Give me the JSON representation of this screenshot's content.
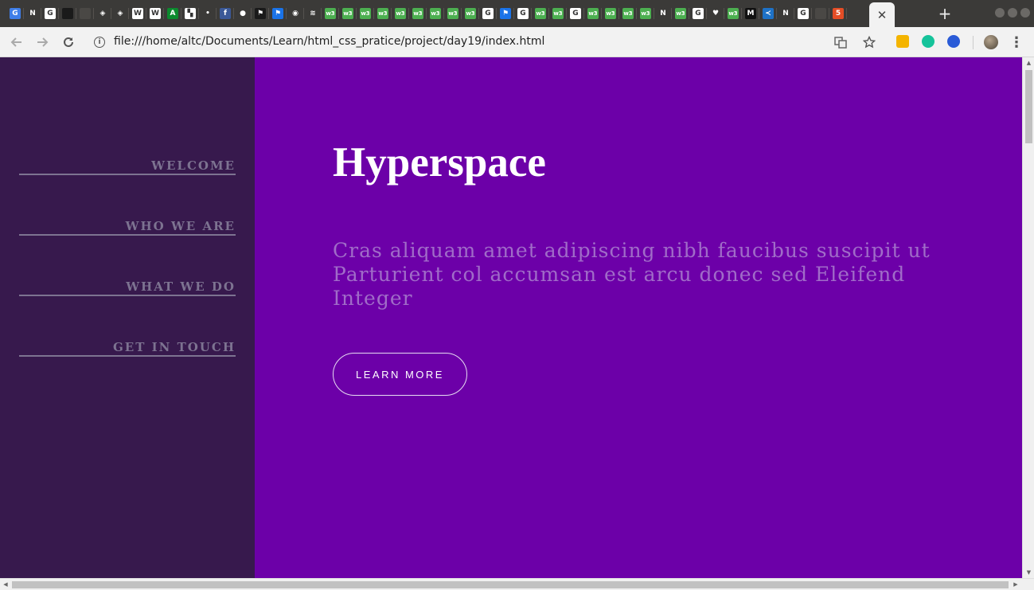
{
  "browser": {
    "tabs": [
      {
        "icon": "google-drive-icon",
        "glyph": "G",
        "color": "#3f7ee8"
      },
      {
        "icon": "n-tab-icon",
        "glyph": "N",
        "color": "#3b3a38"
      },
      {
        "icon": "google-icon",
        "glyph": "G",
        "color": "#ffffff"
      },
      {
        "icon": "save-icon",
        "glyph": "",
        "color": "#1a1a1a"
      },
      {
        "icon": "blank-page-icon",
        "glyph": "",
        "color": "#4a4845"
      },
      {
        "icon": "codepen-icon",
        "glyph": "◈",
        "color": "#3b3a38"
      },
      {
        "icon": "codepen-icon",
        "glyph": "◈",
        "color": "#3b3a38"
      },
      {
        "icon": "wikipedia-icon",
        "glyph": "W",
        "color": "#ffffff"
      },
      {
        "icon": "wikipedia-icon",
        "glyph": "W",
        "color": "#ffffff"
      },
      {
        "icon": "green-a-icon",
        "glyph": "A",
        "color": "#0b8a2e"
      },
      {
        "icon": "checker-icon",
        "glyph": "▚",
        "color": "#ffffff"
      },
      {
        "icon": "dots-icon",
        "glyph": "•",
        "color": "#3b3a38"
      },
      {
        "icon": "facebook-icon",
        "glyph": "f",
        "color": "#3b5998"
      },
      {
        "icon": "github-icon",
        "glyph": "●",
        "color": "#3b3a38"
      },
      {
        "icon": "flag-icon",
        "glyph": "⚑",
        "color": "#1a1a1a"
      },
      {
        "icon": "flag-blue-icon",
        "glyph": "⚑",
        "color": "#1a73e8"
      },
      {
        "icon": "circle-icon",
        "glyph": "◉",
        "color": "#3b3a38"
      },
      {
        "icon": "stack-icon",
        "glyph": "≋",
        "color": "#3b3a38"
      },
      {
        "icon": "w3-icon",
        "glyph": "w3",
        "color": "#4caf50"
      },
      {
        "icon": "w3-icon",
        "glyph": "w3",
        "color": "#4caf50"
      },
      {
        "icon": "w3-icon",
        "glyph": "w3",
        "color": "#4caf50"
      },
      {
        "icon": "w3-icon",
        "glyph": "w3",
        "color": "#4caf50"
      },
      {
        "icon": "w3-icon",
        "glyph": "w3",
        "color": "#4caf50"
      },
      {
        "icon": "w3-icon",
        "glyph": "w3",
        "color": "#4caf50"
      },
      {
        "icon": "w3-icon",
        "glyph": "w3",
        "color": "#4caf50"
      },
      {
        "icon": "w3-icon",
        "glyph": "w3",
        "color": "#4caf50"
      },
      {
        "icon": "w3-icon",
        "glyph": "w3",
        "color": "#4caf50"
      },
      {
        "icon": "google-icon",
        "glyph": "G",
        "color": "#ffffff"
      },
      {
        "icon": "flag-blue-icon",
        "glyph": "⚑",
        "color": "#1a73e8"
      },
      {
        "icon": "google-icon",
        "glyph": "G",
        "color": "#ffffff"
      },
      {
        "icon": "w3-icon",
        "glyph": "w3",
        "color": "#4caf50"
      },
      {
        "icon": "w3-icon",
        "glyph": "w3",
        "color": "#4caf50"
      },
      {
        "icon": "google-icon",
        "glyph": "G",
        "color": "#ffffff"
      },
      {
        "icon": "w3-icon",
        "glyph": "w3",
        "color": "#4caf50"
      },
      {
        "icon": "w3-icon",
        "glyph": "w3",
        "color": "#4caf50"
      },
      {
        "icon": "w3-icon",
        "glyph": "w3",
        "color": "#4caf50"
      },
      {
        "icon": "w3-icon",
        "glyph": "w3",
        "color": "#4caf50"
      },
      {
        "icon": "n-tab-icon",
        "glyph": "N",
        "color": "#3b3a38"
      },
      {
        "icon": "w3-icon",
        "glyph": "w3",
        "color": "#4caf50"
      },
      {
        "icon": "google-icon",
        "glyph": "G",
        "color": "#ffffff"
      },
      {
        "icon": "heart-icon",
        "glyph": "♥",
        "color": "#3b3a38"
      },
      {
        "icon": "w3-icon",
        "glyph": "w3",
        "color": "#4caf50"
      },
      {
        "icon": "medium-icon",
        "glyph": "M",
        "color": "#111111"
      },
      {
        "icon": "vscode-icon",
        "glyph": "≺",
        "color": "#1e72c7"
      },
      {
        "icon": "n-tab-icon",
        "glyph": "N",
        "color": "#3b3a38"
      },
      {
        "icon": "google-icon",
        "glyph": "G",
        "color": "#ffffff"
      },
      {
        "icon": "blank-page-icon",
        "glyph": "",
        "color": "#4a4845"
      },
      {
        "icon": "html5-icon",
        "glyph": "5",
        "color": "#e44d26"
      }
    ],
    "active_tab_close": "✕",
    "new_tab": "+",
    "url": "file:///home/altc/Documents/Learn/html_css_pratice/project/day19/index.html",
    "info_glyph": "i"
  },
  "page": {
    "colors": {
      "main_bg": "#6c00a8",
      "sidebar_bg": "#37194d",
      "nav_text": "#7d7391",
      "lead_text": "#a06cc8"
    },
    "nav": [
      {
        "label": "WELCOME"
      },
      {
        "label": "WHO WE ARE"
      },
      {
        "label": "WHAT WE DO"
      },
      {
        "label": "GET IN TOUCH"
      }
    ],
    "title": "Hyperspace",
    "lead": "Cras aliquam amet adipiscing nibh faucibus suscipit ut Parturient col accumsan est arcu donec sed Eleifend Integer",
    "cta_label": "LEARN MORE"
  }
}
